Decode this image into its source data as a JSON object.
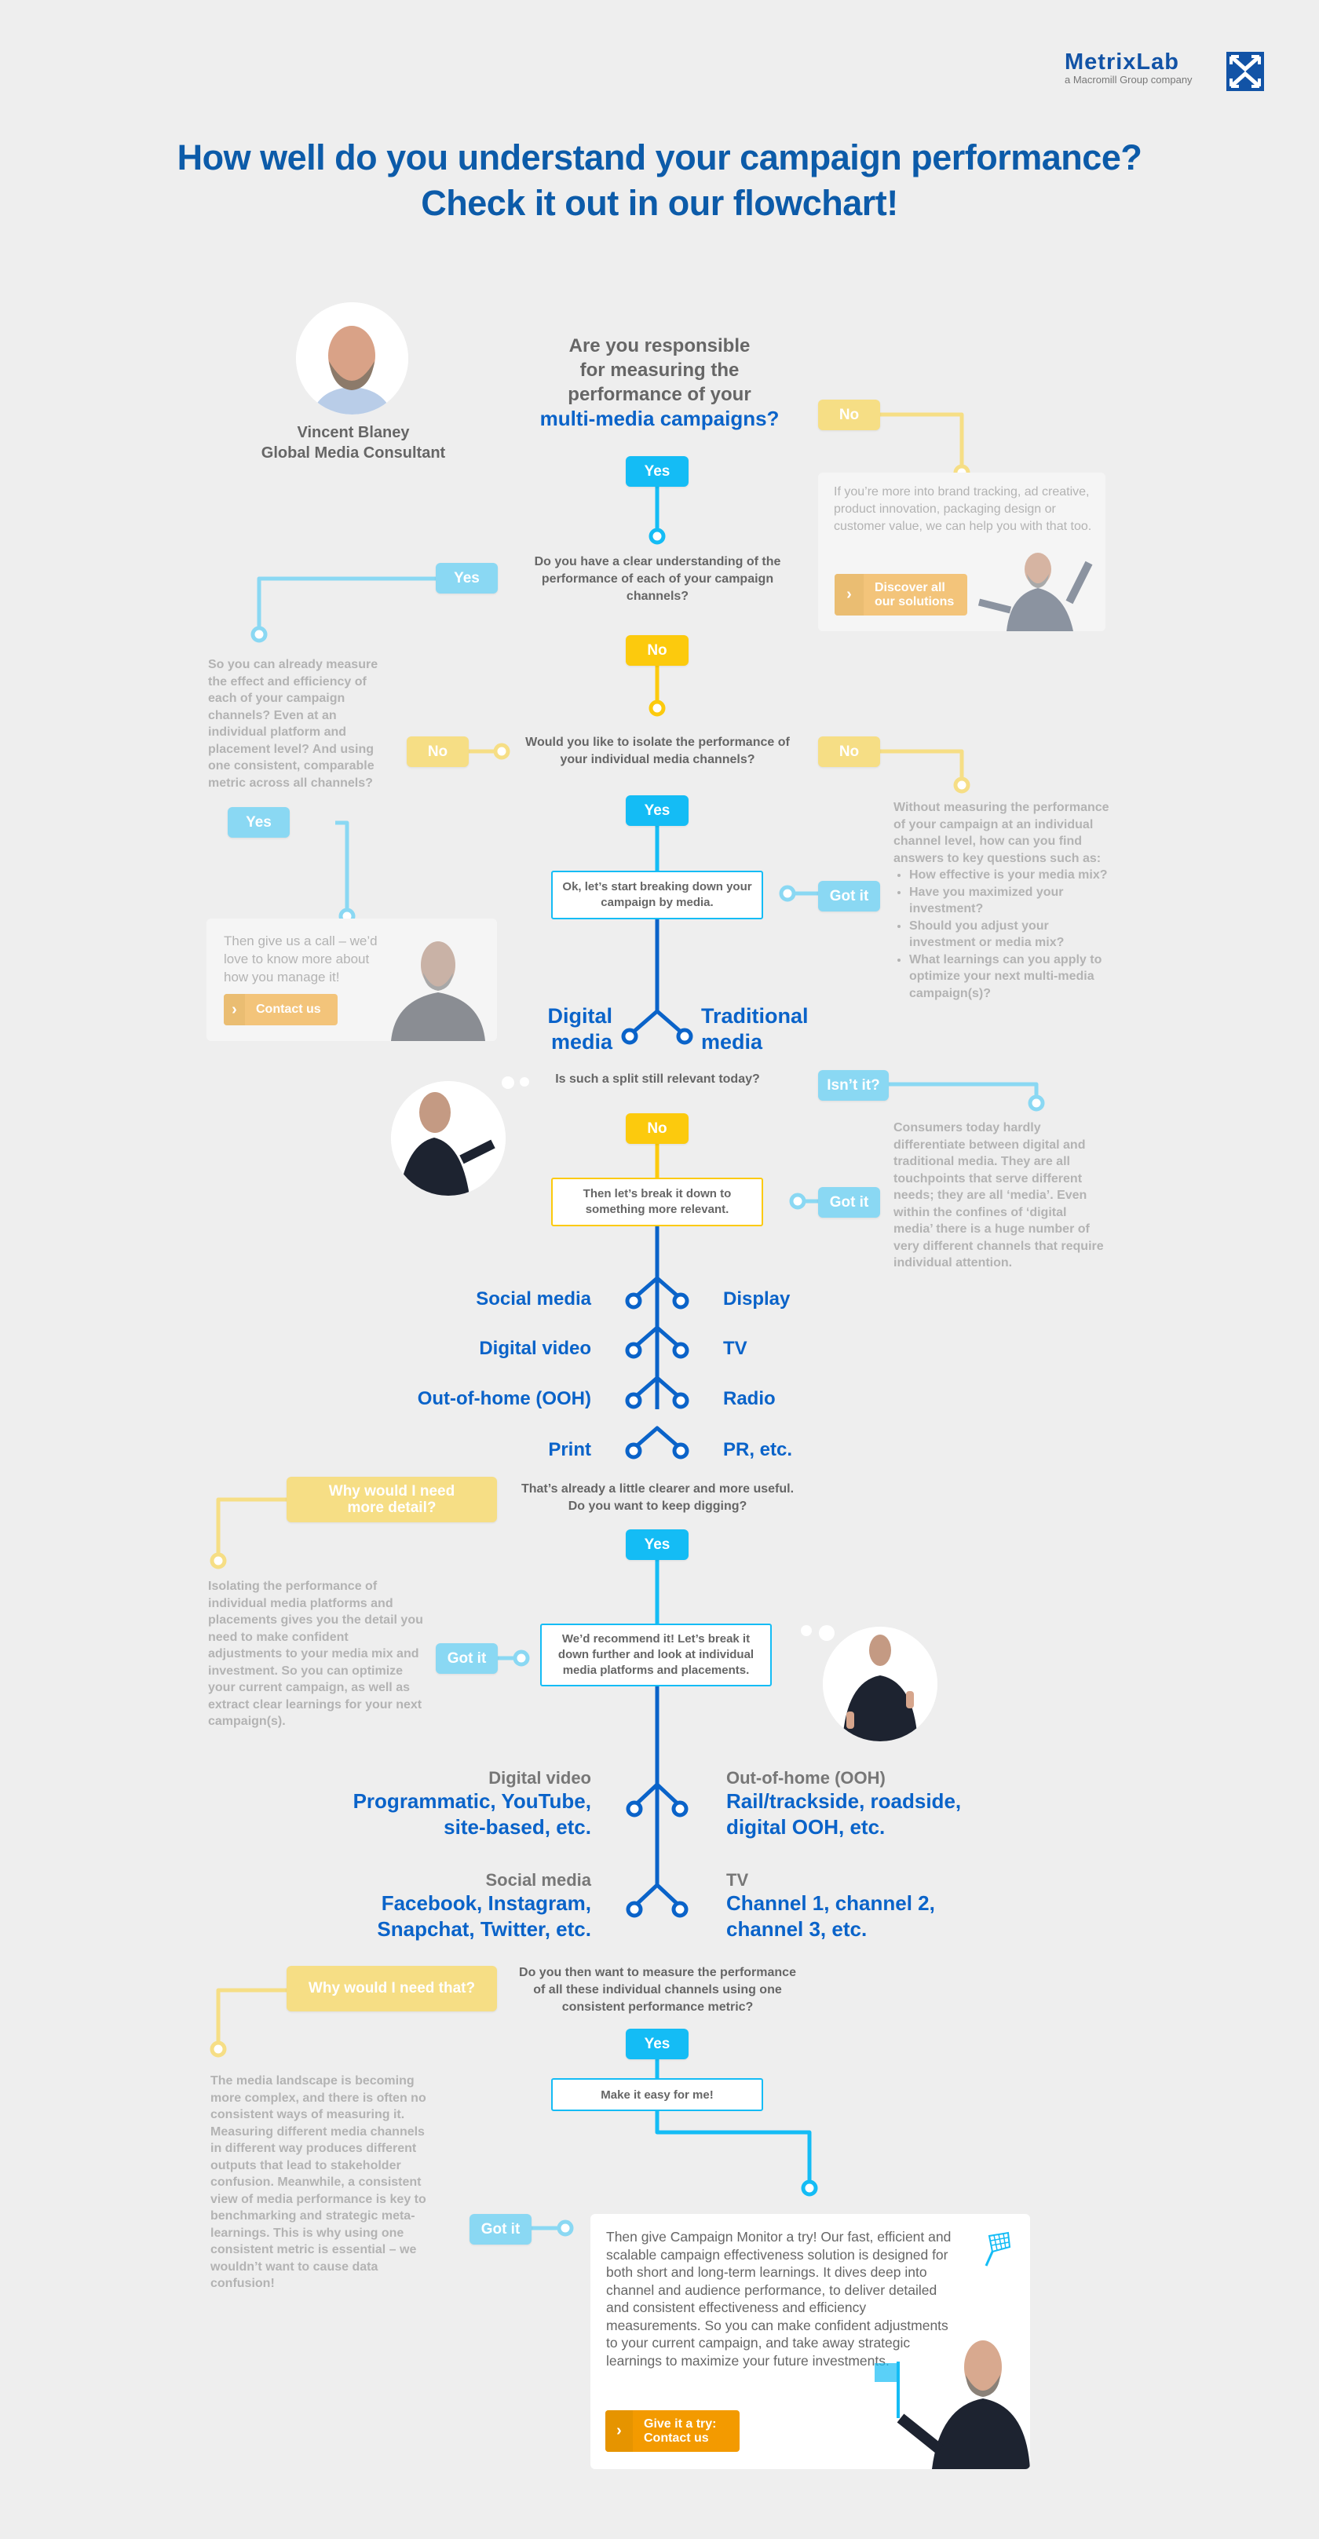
{
  "brand": {
    "name": "MetrixLab",
    "tagline": "a Macromill Group company",
    "colors": {
      "primary_blue": "#0c5ba9",
      "cyan": "#14bcf5",
      "yellow": "#fcca0d",
      "orange": "#f39a00",
      "media_blue": "#0a63c9"
    }
  },
  "title": {
    "line1": "How well do you understand your campaign performance?",
    "line2": "Check it out in our flowchart!"
  },
  "consultant": {
    "name": "Vincent Blaney",
    "role": "Global Media Consultant"
  },
  "q1": {
    "line1": "Are you responsible",
    "line2": "for measuring the",
    "line3": "performance of your",
    "highlight": "multi-media campaigns?",
    "yes": "Yes",
    "no": "No",
    "no_card": {
      "text": "If you’re more into brand tracking, ad creative, product innovation,  packaging design or customer value, we can help you with that too.",
      "button": "Discover all our solutions"
    }
  },
  "q2": {
    "text": "Do you have a clear understanding of the performance of each of your campaign channels?",
    "yes": "Yes",
    "no": "No",
    "yes_text": "So you can already measure the effect and efficiency of each of your campaign channels? Even at an individual platform and placement level? And using one consistent, comparable metric across all channels?",
    "yes_no": "No",
    "yes_yes": "Yes",
    "call_card": {
      "text": "Then give us a call – we’d love to know more about how you manage it!",
      "button": "Contact us"
    }
  },
  "q3": {
    "text": "Would you like to isolate the performance of your individual media channels?",
    "yes": "Yes",
    "no": "No",
    "no_text_intro": "Without measuring the performance of your campaign at an individual channel level, how can you find answers to key questions such as:",
    "no_bullets": [
      "How effective is your media mix?",
      "Have you maximized your investment?",
      "Should you adjust your investment or media mix?",
      "What learnings can you apply to optimize your next multi-media campaign(s)?"
    ],
    "got_it": "Got it"
  },
  "step1": {
    "box": "Ok, let’s start breaking down your campaign by media.",
    "left": "Digital media",
    "right": "Traditional media"
  },
  "q4": {
    "text": "Is such a split still relevant today?",
    "no": "No",
    "isnt_it": "Isn’t it?",
    "isnt_text": "Consumers today hardly differentiate between digital and traditional media. They are all touchpoints that serve different needs; they are all ‘media’. Even within the confines of ‘digital media’ there is a huge number of very different channels that require individual attention.",
    "got_it": "Got it",
    "box": "Then let’s break it down to something more relevant."
  },
  "channels": [
    {
      "left": "Social media",
      "right": "Display"
    },
    {
      "left": "Digital video",
      "right": "TV"
    },
    {
      "left": "Out-of-home (OOH)",
      "right": "Radio"
    },
    {
      "left": "Print",
      "right": "PR, etc."
    }
  ],
  "q5": {
    "line1": "That’s already a little clearer and more useful.",
    "line2": "Do you want to keep digging?",
    "yes": "Yes",
    "why": "Why would I need more detail?",
    "why_text": "Isolating the performance of individual media platforms and placements gives you the detail you need to make confident adjustments to your media mix and investment. So you can optimize your current campaign, as well as extract clear learnings for your next campaign(s).",
    "got_it": "Got it",
    "box": "We’d recommend it! Let’s break it down further and look at individual media platforms and placements."
  },
  "platforms": [
    {
      "category": "Digital video",
      "detail": "Programmatic, YouTube, site-based, etc."
    },
    {
      "category": "Out-of-home (OOH)",
      "detail": "Rail/trackside, roadside, digital OOH, etc."
    },
    {
      "category": "Social media",
      "detail": "Facebook, Instagram, Snapchat, Twitter, etc."
    },
    {
      "category": "TV",
      "detail": "Channel 1, channel 2, channel 3, etc."
    }
  ],
  "q6": {
    "text": "Do you then want to measure the performance of all these individual channels using one consistent performance metric?",
    "yes": "Yes",
    "why": "Why would I need that?",
    "why_text": "The media landscape is becoming more complex, and there is often no consistent ways of measuring it. Measuring different media channels in different way produces different outputs that lead to stakeholder confusion. Meanwhile, a consistent view of media performance is key to benchmarking and strategic meta-learnings. This is why using one consistent metric is essential – we wouldn’t want to cause data confusion!",
    "got_it": "Got it",
    "box": "Make it easy for me!"
  },
  "final": {
    "text": "Then give Campaign Monitor a try! Our fast, efficient and scalable campaign effectiveness solution is designed for both short and long-term learnings. It dives deep into channel and audience performance, to deliver detailed and consistent effectiveness and efficiency measurements. So you can make confident adjustments to your current campaign, and take away strategic learnings to maximize your future investments.",
    "button_line1": "Give it a try:",
    "button_line2": "Contact us"
  }
}
